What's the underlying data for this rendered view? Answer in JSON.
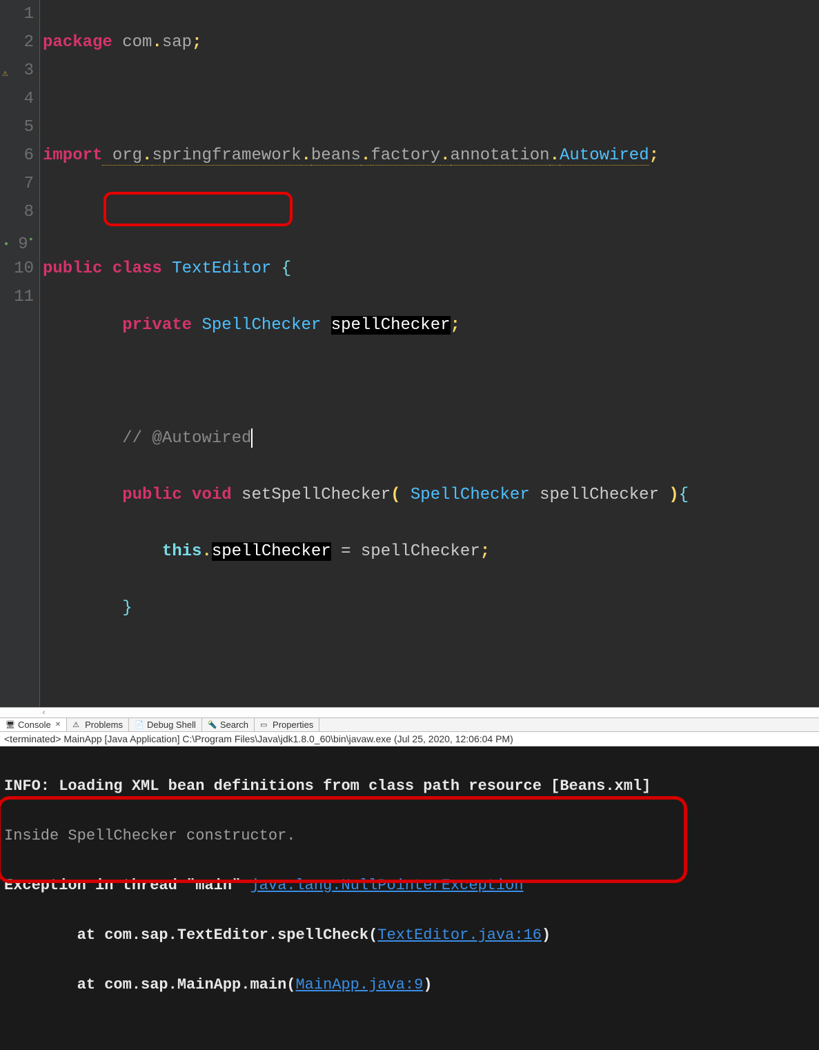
{
  "editor": {
    "lines": {
      "l1_kw": "package",
      "l1_pkg": " com",
      "l1_dot1": ".",
      "l1_pkg2": "sap",
      "l1_semi": ";",
      "l3_kw": "import",
      "l3_pkg": " org",
      "l3_d1": ".",
      "l3_p2": "springframework",
      "l3_d2": ".",
      "l3_p3": "beans",
      "l3_d3": ".",
      "l3_p4": "factory",
      "l3_d4": ".",
      "l3_p5": "annotation",
      "l3_d5": ".",
      "l3_cls": "Autowired",
      "l3_semi": ";",
      "l5_kw1": "public",
      "l5_kw2": " class",
      "l5_cls": " TextEditor",
      "l5_brace": " {",
      "l6_kw": "private",
      "l6_ty": " SpellChecker ",
      "l6_hl": "spellChecker",
      "l6_semi": ";",
      "l8_comment": "// @Autowired",
      "l9_kw1": "public",
      "l9_kw2": " void",
      "l9_mname": " setSpellChecker",
      "l9_po": "(",
      "l9_ty": " SpellChecker",
      "l9_param": " spellChecker ",
      "l9_pc": ")",
      "l9_brace": "{",
      "l10_this": "this",
      "l10_dot": ".",
      "l10_hl": "spellChecker",
      "l10_eq": " = ",
      "l10_rhs": "spellChecker",
      "l10_semi": ";",
      "l11_brace": "}"
    },
    "line_numbers": [
      "1",
      "2",
      "3",
      "4",
      "5",
      "6",
      "7",
      "8",
      "9",
      "10",
      "11"
    ],
    "line9_marker": "9"
  },
  "tabs": {
    "console": "Console",
    "problems": "Problems",
    "debug_shell": "Debug Shell",
    "search": "Search",
    "properties": "Properties"
  },
  "status": "<terminated> MainApp [Java Application] C:\\Program Files\\Java\\jdk1.8.0_60\\bin\\javaw.exe (Jul 25, 2020, 12:06:04 PM)",
  "console": {
    "l1": "INFO: Loading XML bean definitions from class path resource [Beans.xml]",
    "l2": "Inside SpellChecker constructor.",
    "l3a": "Exception in thread \"main\" ",
    "l3link": "java.lang.NullPointerException",
    "l4a": "        at com.sap.TextEditor.spellCheck(",
    "l4link": "TextEditor.java:16",
    "l4b": ")",
    "l5a": "        at com.sap.MainApp.main(",
    "l5link": "MainApp.java:9",
    "l5b": ")"
  }
}
